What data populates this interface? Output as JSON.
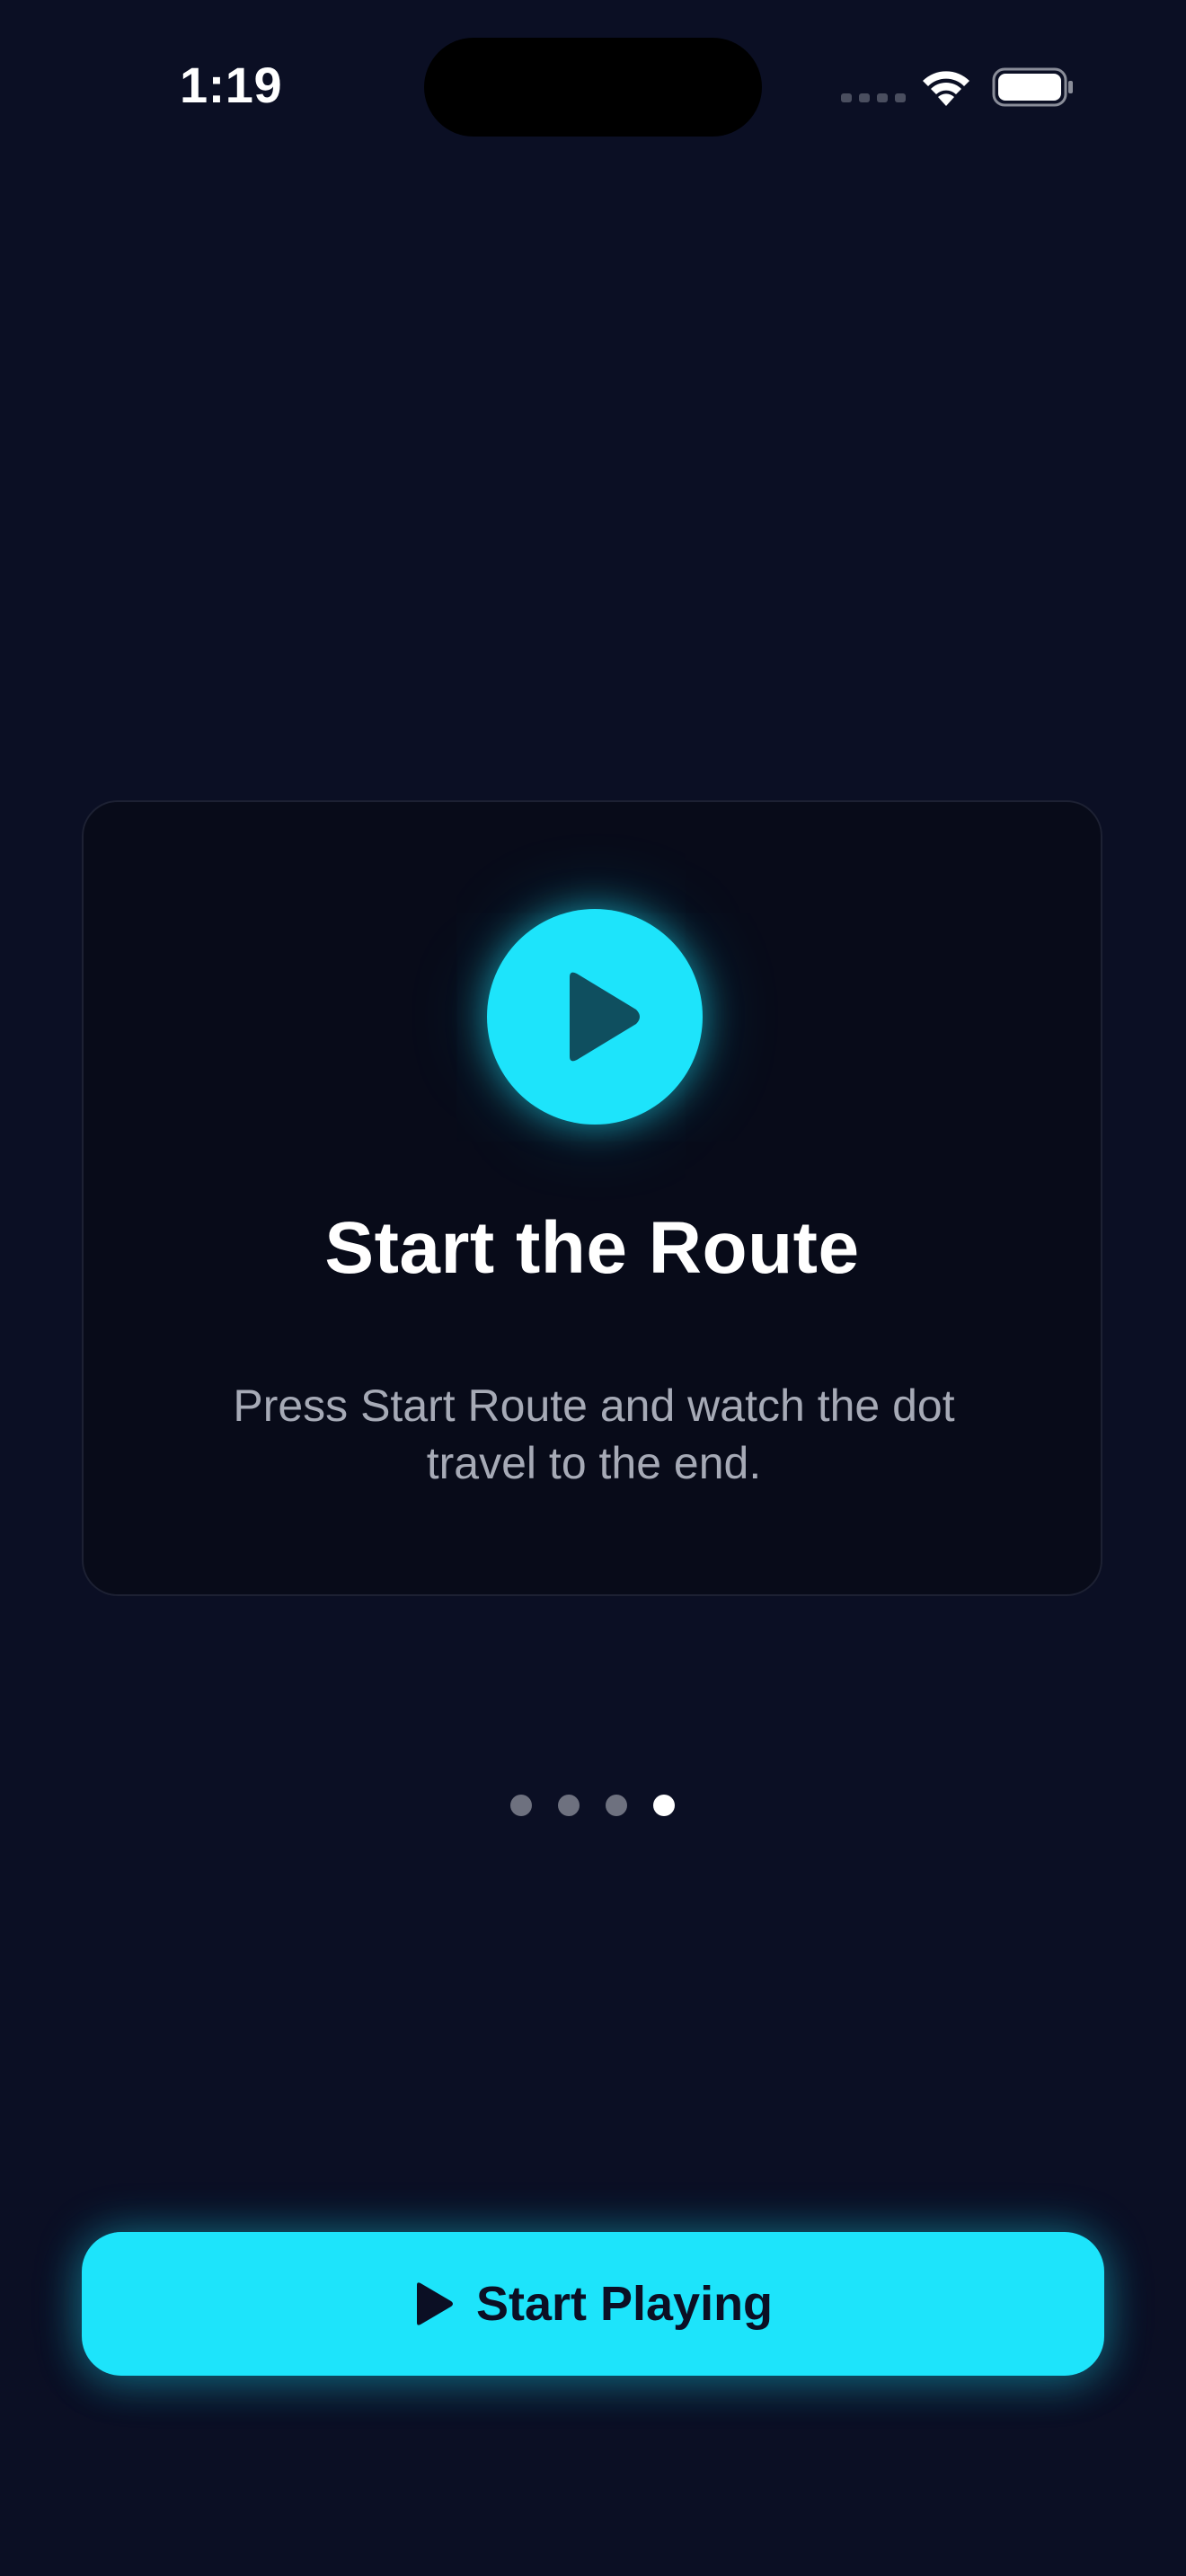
{
  "status_bar": {
    "time": "1:19"
  },
  "card": {
    "icon": "play-icon",
    "title": "Start the Route",
    "description": "Press Start Route and watch the dot travel to the end."
  },
  "pagination": {
    "total": 4,
    "current": 4
  },
  "start_button": {
    "icon": "play-icon",
    "label": "Start Playing"
  },
  "colors": {
    "background": "#0b0f24",
    "card_background": "#080b19",
    "accent": "#1de4fb",
    "muted_text": "#a6aab6"
  }
}
